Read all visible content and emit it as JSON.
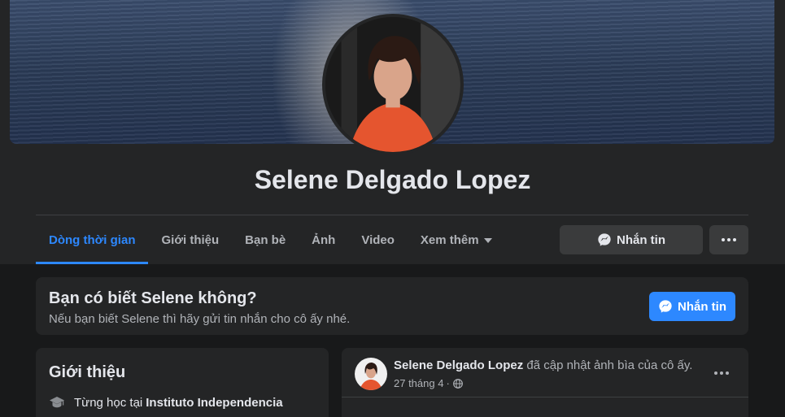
{
  "profile": {
    "name": "Selene Delgado Lopez"
  },
  "tabs": [
    {
      "label": "Dòng thời gian",
      "active": true
    },
    {
      "label": "Giới thiệu"
    },
    {
      "label": "Bạn bè"
    },
    {
      "label": "Ảnh"
    },
    {
      "label": "Video"
    },
    {
      "label": "Xem thêm"
    }
  ],
  "actions": {
    "message_label": "Nhắn tin"
  },
  "know_card": {
    "title": "Bạn có biết Selene không?",
    "subtitle": "Nếu bạn biết Selene thì hãy gửi tin nhắn cho cô ấy nhé.",
    "button_label": "Nhắn tin"
  },
  "intro": {
    "title": "Giới thiệu",
    "study_prefix": "Từng học tại",
    "school": "Instituto Independencia"
  },
  "post": {
    "author": "Selene Delgado Lopez",
    "action": "đã cập nhật ảnh bìa của cô ấy.",
    "date": "27 tháng 4",
    "separator": "·",
    "privacy_icon": "globe-icon"
  },
  "colors": {
    "accent": "#2d88ff",
    "background": "#18191a",
    "card": "#242526",
    "button": "#3a3b3c",
    "text_primary": "#e4e6eb",
    "text_secondary": "#b0b3b8"
  }
}
